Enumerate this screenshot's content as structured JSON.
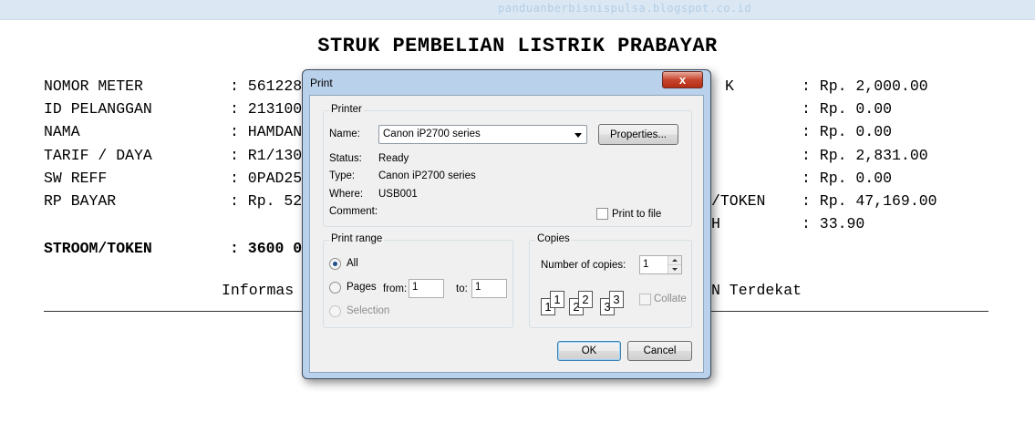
{
  "watermark": "panduanberbisnispulsa.blogspot.co.id",
  "receipt": {
    "title": "STRUK PEMBELIAN LISTRIK PRABAYAR",
    "left_labels": [
      "NOMOR METER",
      "ID PELANGGAN",
      "NAMA",
      "TARIF / DAYA",
      "SW REFF",
      "RP BAYAR"
    ],
    "left_values": [
      ": 561228",
      ": 213100",
      ": HAMDAN",
      ": R1/130",
      ": 0PAD25",
      ": Rp. 52"
    ],
    "token_label": "STROOM/TOKEN",
    "token_value": ": 3600 0",
    "right_labels": [
      "K",
      "/TOKEN",
      "H"
    ],
    "right_values": [
      ": Rp. 2,000.00",
      ": Rp. 0.00",
      ": Rp. 0.00",
      ": Rp. 2,831.00",
      ": Rp. 0.00",
      ": Rp. 47,169.00",
      ": 33.90"
    ],
    "info_left": "Informas",
    "info_right": "N Terdekat"
  },
  "dialog": {
    "title": "Print",
    "close_symbol": "x",
    "printer": {
      "group_label": "Printer",
      "name_label": "Name:",
      "name_value": "Canon iP2700 series",
      "properties_button": "Properties...",
      "status_label": "Status:",
      "status_value": "Ready",
      "type_label": "Type:",
      "type_value": "Canon iP2700 series",
      "where_label": "Where:",
      "where_value": "USB001",
      "comment_label": "Comment:",
      "print_to_file": "Print to file"
    },
    "range": {
      "group_label": "Print range",
      "all": "All",
      "pages": "Pages",
      "from_label": "from:",
      "from_value": "1",
      "to_label": "to:",
      "to_value": "1",
      "selection": "Selection"
    },
    "copies": {
      "group_label": "Copies",
      "number_label": "Number of copies:",
      "number_value": "1",
      "collate": "Collate",
      "pages": [
        "1",
        "1",
        "2",
        "2",
        "3",
        "3"
      ]
    },
    "ok_button": "OK",
    "cancel_button": "Cancel"
  }
}
